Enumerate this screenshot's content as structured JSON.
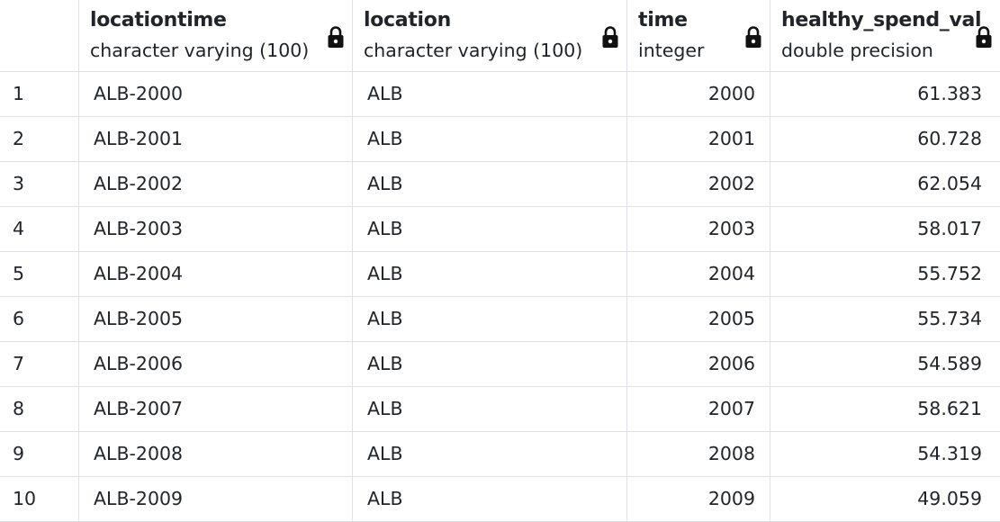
{
  "columns": [
    {
      "name": "locationtime",
      "type": "character varying (100)"
    },
    {
      "name": "location",
      "type": "character varying (100)"
    },
    {
      "name": "time",
      "type": "integer"
    },
    {
      "name": "healthy_spend_val",
      "type": "double precision"
    }
  ],
  "rows": [
    {
      "num": "1",
      "locationtime": "ALB-2000",
      "location": "ALB",
      "time": "2000",
      "value": "61.383"
    },
    {
      "num": "2",
      "locationtime": "ALB-2001",
      "location": "ALB",
      "time": "2001",
      "value": "60.728"
    },
    {
      "num": "3",
      "locationtime": "ALB-2002",
      "location": "ALB",
      "time": "2002",
      "value": "62.054"
    },
    {
      "num": "4",
      "locationtime": "ALB-2003",
      "location": "ALB",
      "time": "2003",
      "value": "58.017"
    },
    {
      "num": "5",
      "locationtime": "ALB-2004",
      "location": "ALB",
      "time": "2004",
      "value": "55.752"
    },
    {
      "num": "6",
      "locationtime": "ALB-2005",
      "location": "ALB",
      "time": "2005",
      "value": "55.734"
    },
    {
      "num": "7",
      "locationtime": "ALB-2006",
      "location": "ALB",
      "time": "2006",
      "value": "54.589"
    },
    {
      "num": "8",
      "locationtime": "ALB-2007",
      "location": "ALB",
      "time": "2007",
      "value": "58.621"
    },
    {
      "num": "9",
      "locationtime": "ALB-2008",
      "location": "ALB",
      "time": "2008",
      "value": "54.319"
    },
    {
      "num": "10",
      "locationtime": "ALB-2009",
      "location": "ALB",
      "time": "2009",
      "value": "49.059"
    }
  ],
  "icons": {
    "column_lock": "lock-icon"
  }
}
